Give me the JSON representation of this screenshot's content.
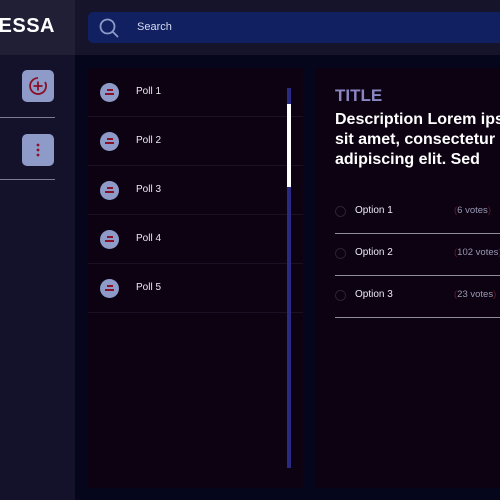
{
  "app": {
    "brand": "DESSA"
  },
  "search": {
    "placeholder": "Search"
  },
  "sidebar": {
    "buttons": [
      {
        "name": "add",
        "icon": "plus-circle-icon"
      },
      {
        "name": "more",
        "icon": "more-vertical-icon"
      }
    ]
  },
  "polls": {
    "items": [
      {
        "label": "Poll 1",
        "icon": "poll-icon"
      },
      {
        "label": "Poll 2",
        "icon": "poll-icon"
      },
      {
        "label": "Poll 3",
        "icon": "poll-icon"
      },
      {
        "label": "Poll 4",
        "icon": "poll-icon"
      },
      {
        "label": "Poll 5",
        "icon": "poll-icon"
      }
    ]
  },
  "detail": {
    "title": "TITLE",
    "description": "Description Lorem ipsum dolor sit amet, consectetur adipiscing elit. Sed",
    "options": [
      {
        "label": "Option 1",
        "votes": "6 votes"
      },
      {
        "label": "Option 2",
        "votes": "102 votes"
      },
      {
        "label": "Option 3",
        "votes": "23 votes"
      }
    ]
  },
  "colors": {
    "accent": "#8e9ac8",
    "icon_glyph": "#8a1028",
    "search_bg": "#102060",
    "title": "#8a86c2"
  }
}
